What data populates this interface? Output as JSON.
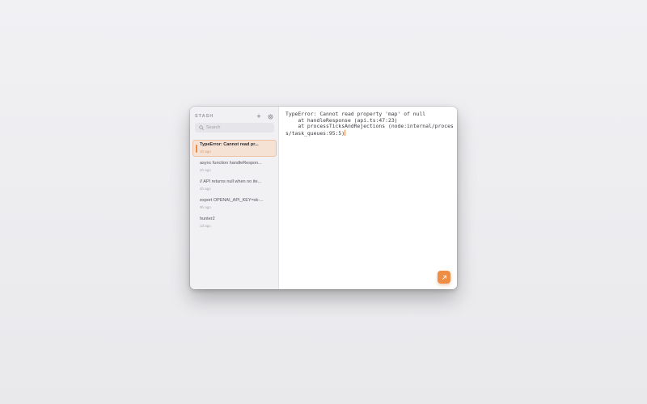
{
  "app": {
    "title": "STASH"
  },
  "header": {
    "add_icon": "plus-icon",
    "settings_icon": "gear-icon"
  },
  "search": {
    "placeholder": "Search",
    "value": "",
    "icon": "search-icon"
  },
  "snippets": [
    {
      "title": "TypeError: Cannot read pr...",
      "time": "1h ago",
      "selected": true
    },
    {
      "title": "async function handleRespon...",
      "time": "2h ago",
      "selected": false
    },
    {
      "title": "// API returns null when no ite...",
      "time": "4h ago",
      "selected": false
    },
    {
      "title": "export OPENAI_API_KEY=sk-...",
      "time": "9h ago",
      "selected": false
    },
    {
      "title": "hunter2",
      "time": "1d ago",
      "selected": false
    }
  ],
  "editor": {
    "content": "TypeError: Cannot read property 'map' of null\n    at handleResponse (api.ts:47:23)\n    at processTicksAndRejections (node:internal/process/task_queues:95:5)"
  },
  "fab": {
    "icon": "arrow-up-right-icon"
  },
  "colors": {
    "accent": "#ee8d45",
    "selected_bg": "#f6e2d4",
    "sidebar_bg": "#f1f1f4"
  }
}
